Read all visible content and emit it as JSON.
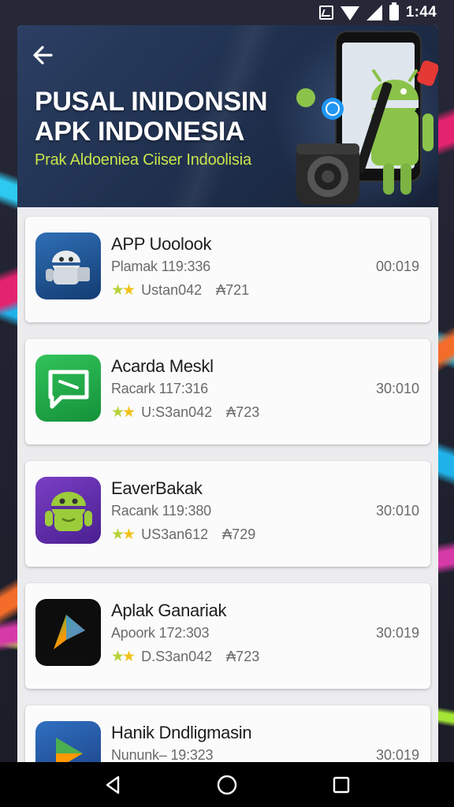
{
  "status_bar": {
    "time": "1:44"
  },
  "header": {
    "title_line1": "PUSAL INIDONSIN",
    "title_line2": "APK INDONESIA",
    "subtitle": "Prak Aldoeniea Ciiser Indoolisia"
  },
  "apps": [
    {
      "name": "APP Uoolook",
      "meta": "Plamak 119:336",
      "size": "00:019",
      "user": "Ustan042",
      "count": "₳721",
      "icon": "android-robot-icon"
    },
    {
      "name": "Acarda Meskl",
      "meta": "Racark 117:316",
      "size": "30:010",
      "user": "U:S3an042",
      "count": "₳723",
      "icon": "chat-bubble-icon"
    },
    {
      "name": "EaverBakak",
      "meta": "Racank 119:380",
      "size": "30:010",
      "user": "US3an612",
      "count": "₳729",
      "icon": "android-face-icon"
    },
    {
      "name": "Aplak Ganariak",
      "meta": "Apoork 172:303",
      "size": "30:019",
      "user": "D.S3an042",
      "count": "₳723",
      "icon": "gradient-p-icon"
    },
    {
      "name": "Hanik Dndligmasin",
      "meta": "Nununk– 19:323",
      "size": "30:019",
      "user": "",
      "count": "",
      "icon": "play-p-icon"
    }
  ],
  "nav": {
    "back": "back-icon",
    "home": "home-icon",
    "recents": "recents-icon"
  },
  "colors": {
    "header_bg": "#203150",
    "subtitle": "#c9e44b",
    "android_green": "#8bc34a",
    "card_bg": "#fbfbfc"
  }
}
